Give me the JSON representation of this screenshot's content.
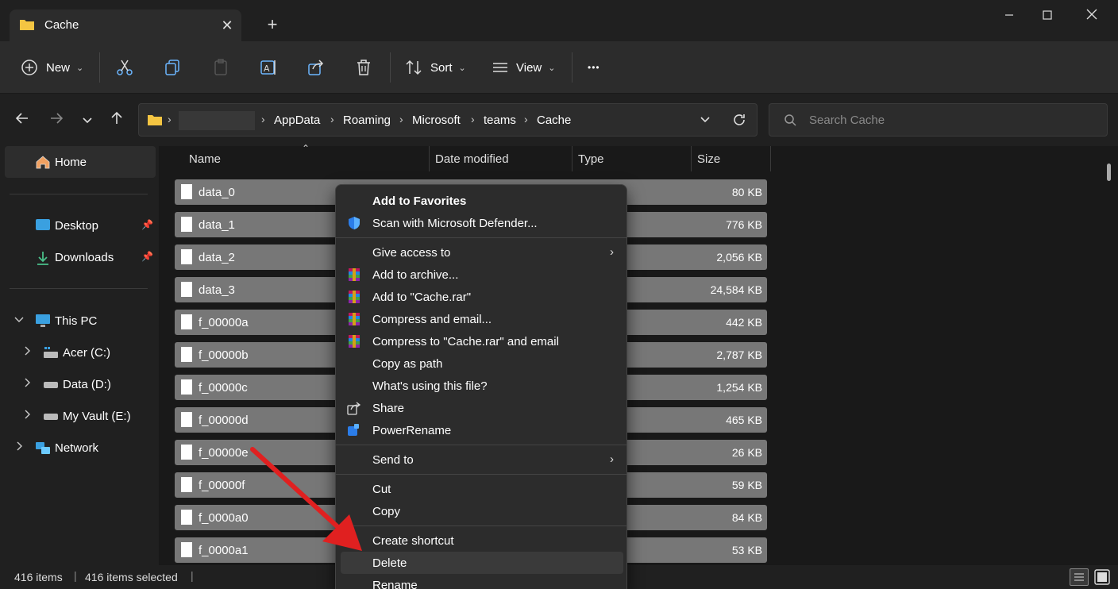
{
  "window": {
    "tab_title": "Cache",
    "new_tab_symbol": "+",
    "close_tab_symbol": "✕"
  },
  "toolbar": {
    "new_label": "New",
    "sort_label": "Sort",
    "view_label": "View",
    "more_symbol": "•••"
  },
  "address": {
    "crumbs": [
      "AppData",
      "Roaming",
      "Microsoft",
      "teams",
      "Cache"
    ],
    "search_placeholder": "Search Cache"
  },
  "sidebar": {
    "home": "Home",
    "desktop": "Desktop",
    "downloads": "Downloads",
    "this_pc": "This PC",
    "drives": [
      "Acer (C:)",
      "Data (D:)",
      "My Vault (E:)"
    ],
    "network": "Network"
  },
  "columns": {
    "name": "Name",
    "date": "Date modified",
    "type": "Type",
    "size": "Size"
  },
  "files": [
    {
      "name": "data_0",
      "size": "80 KB"
    },
    {
      "name": "data_1",
      "size": "776 KB"
    },
    {
      "name": "data_2",
      "size": "2,056 KB"
    },
    {
      "name": "data_3",
      "size": "24,584 KB"
    },
    {
      "name": "f_00000a",
      "size": "442 KB"
    },
    {
      "name": "f_00000b",
      "size": "2,787 KB"
    },
    {
      "name": "f_00000c",
      "size": "1,254 KB"
    },
    {
      "name": "f_00000d",
      "size": "465 KB"
    },
    {
      "name": "f_00000e",
      "size": "26 KB"
    },
    {
      "name": "f_00000f",
      "size": "59 KB"
    },
    {
      "name": "f_0000a0",
      "size": "84 KB"
    },
    {
      "name": "f_0000a1",
      "size": "53 KB"
    }
  ],
  "context_menu": {
    "add_to_favorites": "Add to Favorites",
    "scan_defender": "Scan with Microsoft Defender...",
    "give_access": "Give access to",
    "add_archive": "Add to archive...",
    "add_cache_rar": "Add to \"Cache.rar\"",
    "compress_email": "Compress and email...",
    "compress_cache_email": "Compress to \"Cache.rar\" and email",
    "copy_as_path": "Copy as path",
    "whats_using": "What's using this file?",
    "share": "Share",
    "power_rename": "PowerRename",
    "send_to": "Send to",
    "cut": "Cut",
    "copy": "Copy",
    "create_shortcut": "Create shortcut",
    "delete": "Delete",
    "rename": "Rename"
  },
  "status": {
    "items": "416 items",
    "selected": "416 items selected"
  },
  "colors": {
    "accent_arrow": "#e02020",
    "selection_row": "#777777",
    "menu_bg": "#2c2c2c"
  }
}
